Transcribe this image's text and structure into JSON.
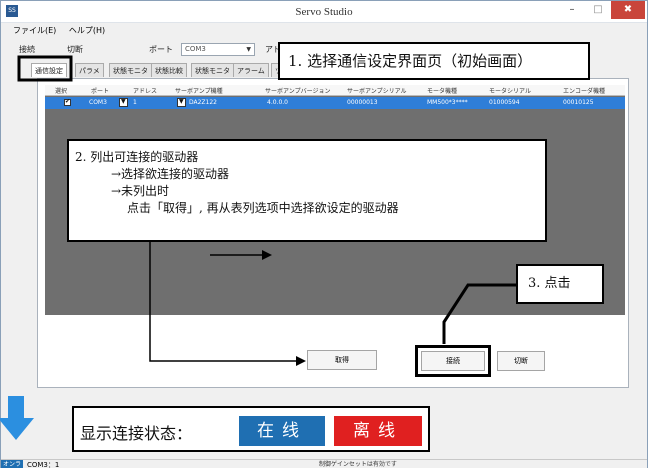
{
  "window": {
    "app_icon": "servo-app-icon",
    "title": "Servo Studio",
    "minimize": "–",
    "maximize": "□",
    "close": "✖"
  },
  "menu": {
    "file": "ファイル(E)",
    "help": "ヘルプ(H)"
  },
  "toolbar": {
    "connect": "接続",
    "disconnect": "切断",
    "port_label": "ポート",
    "port_value": "COM3",
    "address_label": "アドレ"
  },
  "tabs": [
    {
      "label": "通信設定",
      "active": true
    },
    {
      "label": "パラメ"
    },
    {
      "label": "状態モニタ"
    },
    {
      "label": "状態比較"
    },
    {
      "label": "状態モニタ"
    },
    {
      "label": "アラーム"
    },
    {
      "label": "ツ"
    }
  ],
  "grid": {
    "headers": [
      "選択",
      "ポート",
      "アドレス",
      "サーボアンプ機種",
      "サーボアンプバージョン",
      "サーボアンプシリアル",
      "モータ機種",
      "モータシリアル",
      "エンコーダ機種"
    ],
    "row": {
      "selected": true,
      "port": "COM3",
      "address": "1",
      "amp_model": "DA2Z122",
      "amp_version": "4.0.0.0",
      "amp_serial": "00000013",
      "motor_model": "MM500*3****",
      "motor_serial": "01000594",
      "encoder_model": "00010125"
    }
  },
  "buttons": {
    "acquire": "取得",
    "connect": "接続",
    "disconnect": "切断"
  },
  "callouts": {
    "step1": "1. 选择通信设定界面页（初始画面）",
    "step2_title": "2. 列出可连接的驱动器",
    "step2_line1": "→选择欲连接的驱动器",
    "step2_line2": "→未列出时",
    "step2_line3": "点击「取得」, 再从表列选项中选择欲设定的驱动器",
    "step3": "3. 点击"
  },
  "status_legend": {
    "label": "显示连接状态：",
    "online": "在线",
    "offline": "离线"
  },
  "statusbar": {
    "online": "オンライン",
    "port": "COM3：1",
    "message": "制御ゲインセットは有効です"
  },
  "colors": {
    "online": "#1f6fb2",
    "offline": "#e02020",
    "row_highlight": "#2f7ed8",
    "arrow_blue": "#2b8fe0"
  }
}
